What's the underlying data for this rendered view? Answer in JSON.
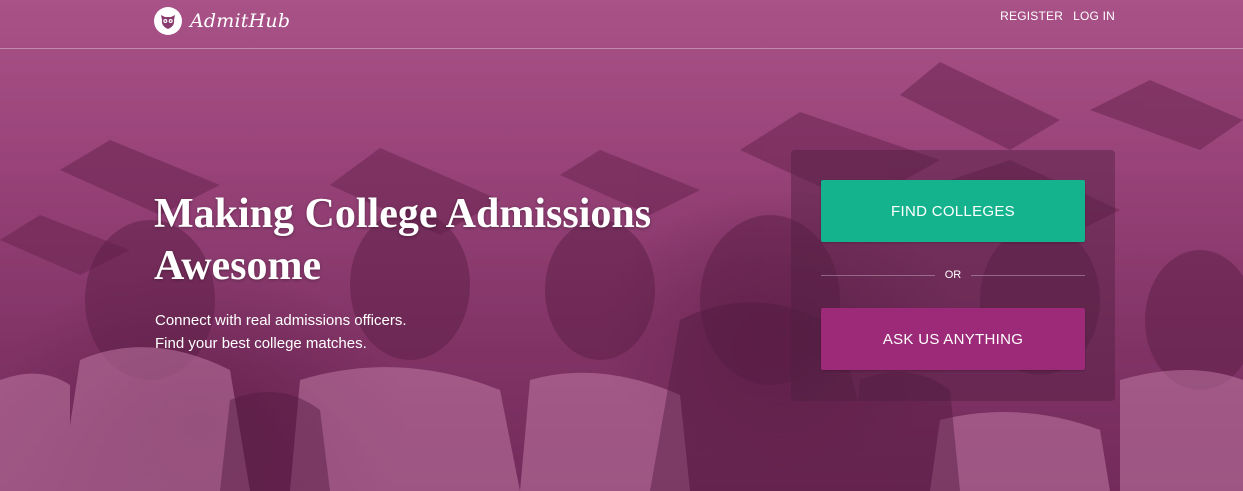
{
  "header": {
    "brand": "AdmitHub",
    "nav": [
      {
        "label": "REGISTER"
      },
      {
        "label": "LOG IN"
      }
    ]
  },
  "hero": {
    "headline_line1": "Making College Admissions",
    "headline_line2": "Awesome",
    "sub_line1": "Connect with real admissions officers.",
    "sub_line2": "Find your best college matches."
  },
  "cta": {
    "find_label": "FIND COLLEGES",
    "or_label": "OR",
    "ask_label": "ASK US ANYTHING"
  },
  "colors": {
    "find_button": "#14b38e",
    "ask_button": "#9c2a78",
    "hero_tint": "#9b4a7e"
  }
}
